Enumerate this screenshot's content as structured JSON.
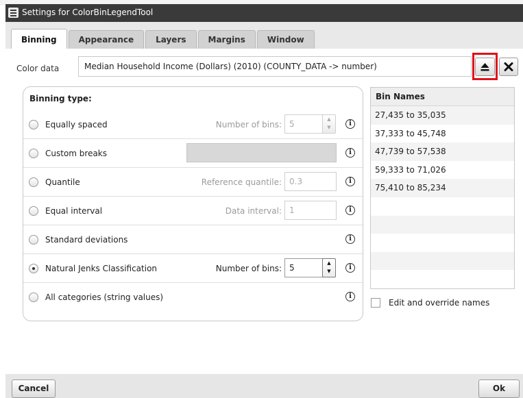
{
  "window": {
    "title": "Settings for ColorBinLegendTool"
  },
  "tabs": [
    {
      "label": "Binning",
      "active": true
    },
    {
      "label": "Appearance",
      "active": false
    },
    {
      "label": "Layers",
      "active": false
    },
    {
      "label": "Margins",
      "active": false
    },
    {
      "label": "Window",
      "active": false
    }
  ],
  "color_data": {
    "label": "Color data",
    "value": "Median Household Income (Dollars) (2010) (COUNTY_DATA -> number)",
    "eject_icon": "eject-icon",
    "clear_icon": "close-icon"
  },
  "binning": {
    "heading": "Binning type:",
    "options": [
      {
        "label": "Equally spaced",
        "selected": false,
        "param_label": "Number of bins:",
        "param_value": "5"
      },
      {
        "label": "Custom breaks",
        "selected": false
      },
      {
        "label": "Quantile",
        "selected": false,
        "param_label": "Reference quantile:",
        "param_value": "0.3"
      },
      {
        "label": "Equal interval",
        "selected": false,
        "param_label": "Data interval:",
        "param_value": "1"
      },
      {
        "label": "Standard deviations",
        "selected": false
      },
      {
        "label": "Natural Jenks Classification",
        "selected": true,
        "param_label": "Number of bins:",
        "param_value": "5"
      },
      {
        "label": "All categories (string values)",
        "selected": false
      }
    ],
    "info_glyph": "i"
  },
  "bin_names": {
    "header": "Bin Names",
    "items": [
      "27,435 to 35,035",
      "37,333 to 45,748",
      "47,739 to 57,538",
      "59,333 to 71,026",
      "75,410 to 85,234"
    ]
  },
  "override": {
    "label": "Edit and override names",
    "checked": false
  },
  "footer": {
    "cancel_label": "Cancel",
    "ok_label": "Ok"
  }
}
